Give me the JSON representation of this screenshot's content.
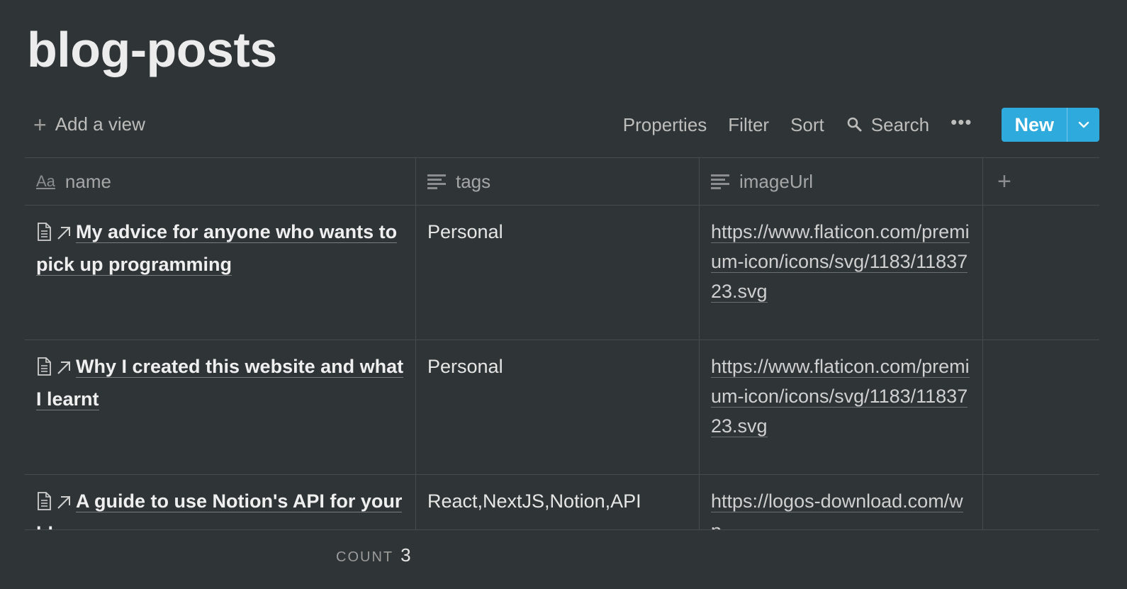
{
  "page": {
    "title": "blog-posts"
  },
  "toolbar": {
    "add_view": "Add a view",
    "properties": "Properties",
    "filter": "Filter",
    "sort": "Sort",
    "search": "Search",
    "more": "•••",
    "new": "New"
  },
  "columns": [
    {
      "label": "name",
      "icon": "title-aa-icon"
    },
    {
      "label": "tags",
      "icon": "text-lines-icon"
    },
    {
      "label": "imageUrl",
      "icon": "text-lines-icon"
    }
  ],
  "add_column": "+",
  "rows": [
    {
      "name": "My advice for anyone who wants to pick up programming",
      "tags": "Personal",
      "imageUrl": "https://www.flaticon.com/premium-icon/icons/svg/1183/1183723.svg"
    },
    {
      "name": "Why I created this website and what I learnt",
      "tags": "Personal",
      "imageUrl": "https://www.flaticon.com/premium-icon/icons/svg/1183/1183723.svg"
    },
    {
      "name": "A guide to use Notion's API for your blog",
      "tags": "React,NextJS,Notion,API",
      "imageUrl": "https://logos-download.com/wp-"
    }
  ],
  "footer": {
    "count_label": "COUNT",
    "count_value": "3"
  },
  "colors": {
    "background": "#2f3437",
    "accent": "#2eaadc",
    "border": "#454b4e"
  }
}
